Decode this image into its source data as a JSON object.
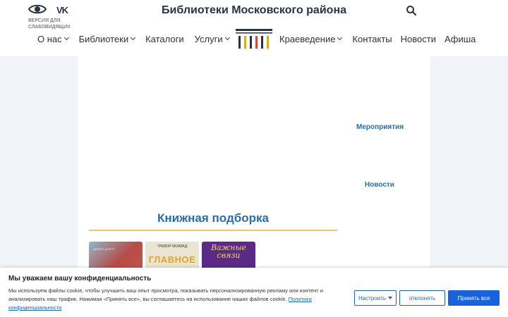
{
  "header": {
    "accessibility_label": "Версия для слабовидящих",
    "vk_label": "VK",
    "site_title": "Библиотеки Московского района"
  },
  "nav": {
    "left": [
      {
        "label": "О нас",
        "dropdown": true
      },
      {
        "label": "Библиотеки",
        "dropdown": true
      },
      {
        "label": "Каталоги",
        "dropdown": false
      },
      {
        "label": "Услуги",
        "dropdown": true
      }
    ],
    "right": [
      {
        "label": "Краеведение",
        "dropdown": true
      },
      {
        "label": "Контакты",
        "dropdown": false
      },
      {
        "label": "Новости",
        "dropdown": false
      },
      {
        "label": "Афиша",
        "dropdown": false
      }
    ]
  },
  "content": {
    "events_link": "Мероприятия",
    "news_link": "Новости",
    "section_title": "Книжная подборка"
  },
  "books": [
    {
      "small_text": "ДЕВЯТЬ ДОРОГ"
    },
    {
      "author": "ТРЕВОР МОАВАД",
      "title": "ГЛАВНОЕ"
    },
    {
      "title": "Важные связи"
    }
  ],
  "cookie": {
    "title": "Мы уважаем вашу конфиденциальность",
    "text": "Мы используем файлы cookie, чтобы улучшить ваш опыт просмотра, показывать персонализированную рекламу или контент и анализировать наш трафик. Нажимая «Принять все», вы соглашаетесь на использование наших файлов cookie.",
    "policy_link": "Политика конфиденциальности",
    "customize_label": "Настроить",
    "reject_label": "отклонять",
    "accept_label": "Принять все"
  },
  "colors": {
    "brand_blue": "#2b6ca8",
    "accent_gold": "#e7c86a",
    "cookie_blue": "#1863dc",
    "nav_text": "#2a3342"
  }
}
